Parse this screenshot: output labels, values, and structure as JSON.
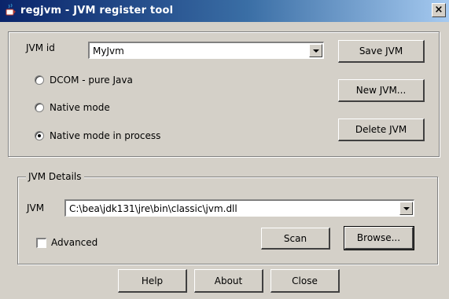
{
  "window": {
    "title": "regjvm - JVM register tool",
    "close_glyph": "×",
    "icon": "java-cup-icon"
  },
  "jvm_select": {
    "label": "JVM id",
    "value": "MyJvm"
  },
  "modes": {
    "options": [
      "DCOM - pure Java",
      "Native mode",
      "Native mode in process"
    ],
    "selected": "Native mode in process"
  },
  "buttons": {
    "save": "Save JVM",
    "new": "New JVM...",
    "delete": "Delete JVM",
    "scan": "Scan",
    "browse": "Browse...",
    "help": "Help",
    "about": "About",
    "close": "Close"
  },
  "details": {
    "group_label": "JVM Details",
    "jvm_label": "JVM",
    "jvm_path": "C:\\bea\\jdk131\\jre\\bin\\classic\\jvm.dll",
    "advanced_label": "Advanced",
    "advanced_checked": false
  }
}
